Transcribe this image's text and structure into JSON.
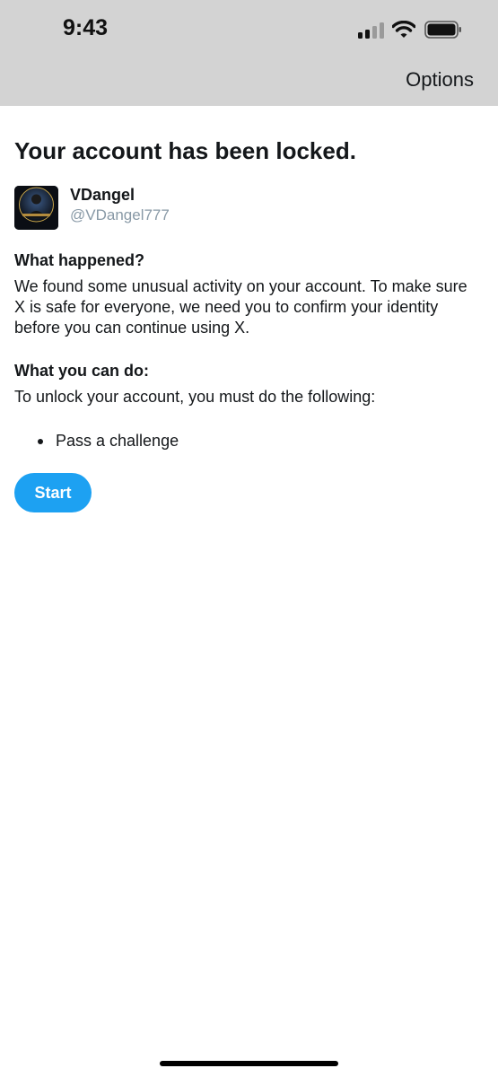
{
  "status_bar": {
    "time": "9:43",
    "icons": [
      "cellular-signal-icon",
      "wifi-icon",
      "battery-icon"
    ]
  },
  "header": {
    "options_label": "Options"
  },
  "main": {
    "title": "Your account has been locked.",
    "account": {
      "name": "VDangel",
      "handle": "@VDangel777"
    },
    "what_happened": {
      "heading": "What happened?",
      "body": "We found some unusual activity on your account. To make sure X is safe for everyone, we need you to confirm your identity before you can continue using X."
    },
    "what_you_can_do": {
      "heading": "What you can do:",
      "body": "To unlock your account, you must do the following:",
      "steps": [
        "Pass a challenge"
      ]
    },
    "start_label": "Start"
  },
  "colors": {
    "status_bar_bg": "#d3d3d3",
    "accent": "#1da1f2",
    "text": "#14171a",
    "muted": "#8899a6"
  }
}
